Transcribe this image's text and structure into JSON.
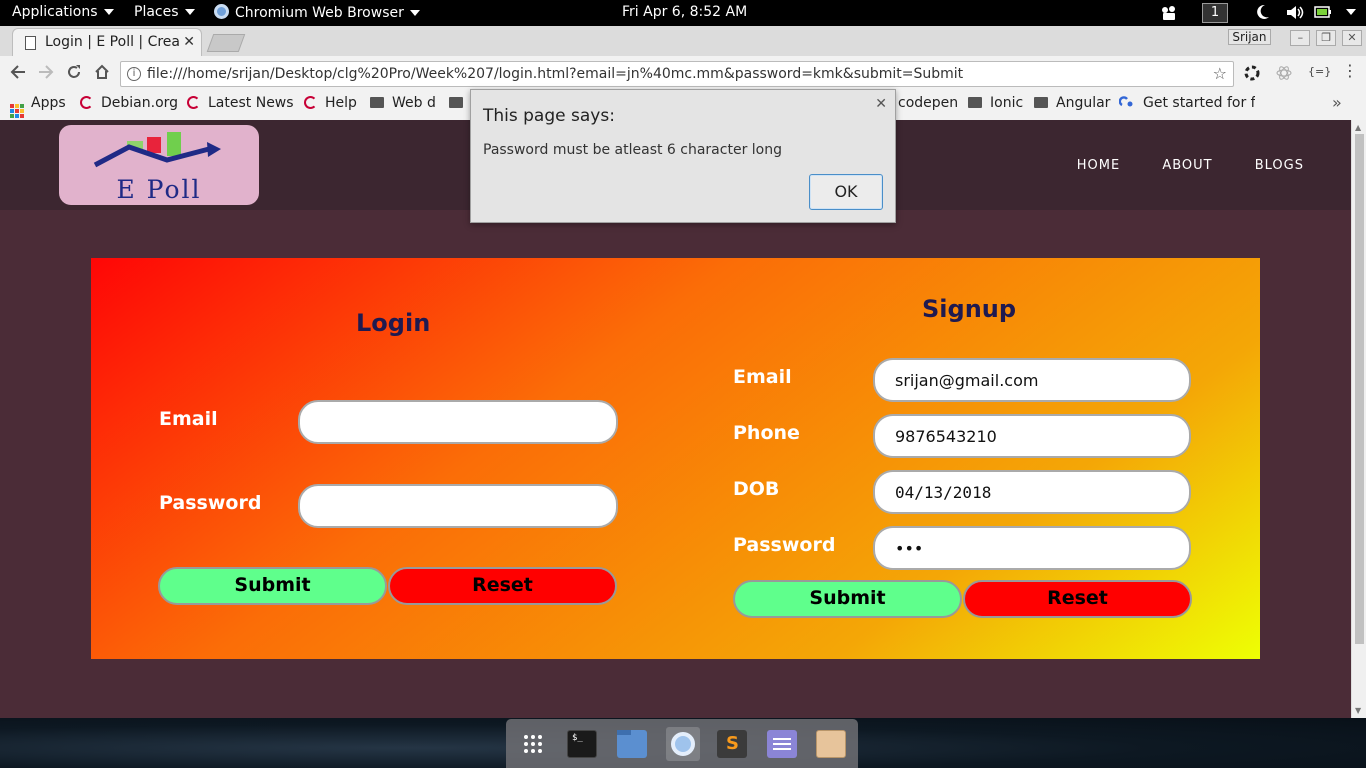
{
  "system_bar": {
    "applications": "Applications",
    "places": "Places",
    "browser_menu": "Chromium Web Browser",
    "clock": "Fri Apr  6,  8:52 AM",
    "workspace": "1"
  },
  "browser": {
    "tab_title": "Login | E Poll | Crea",
    "user_chip": "Srijan",
    "url": "file:///home/srijan/Desktop/clg%20Pro/Week%207/login.html?email=jn%40mc.mm&password=kmk&submit=Submit",
    "bookmarks": [
      "Apps",
      "Debian.org",
      "Latest News",
      "Help",
      "Web d",
      "codepen",
      "Ionic",
      "Angular",
      "Get started for fr"
    ],
    "overflow": "»"
  },
  "site": {
    "logo_text": "E Poll",
    "nav": [
      "HOME",
      "ABOUT",
      "BLOGS"
    ]
  },
  "login": {
    "title": "Login",
    "email_label": "Email",
    "email_value": "",
    "password_label": "Password",
    "password_value": "",
    "submit": "Submit",
    "reset": "Reset"
  },
  "signup": {
    "title": "Signup",
    "email_label": "Email",
    "email_value": "srijan@gmail.com",
    "phone_label": "Phone",
    "phone_value": "9876543210",
    "dob_label": "DOB",
    "dob_value": "04/13/2018",
    "password_label": "Password",
    "password_value": "•••",
    "submit": "Submit",
    "reset": "Reset"
  },
  "dialog": {
    "title": "This page says:",
    "message": "Password must be atleast 6 character long",
    "ok": "OK"
  },
  "dock": [
    "app-grid-icon",
    "terminal-icon",
    "files-icon",
    "chromium-icon",
    "sublime-text-icon",
    "text-editor-icon",
    "archive-icon"
  ],
  "colors": {
    "header_bg": "#3c2630",
    "page_bg": "#4b2c37",
    "submit_green": "#5fff8c",
    "reset_red": "#ff0000",
    "title_color": "#1f1a50"
  }
}
